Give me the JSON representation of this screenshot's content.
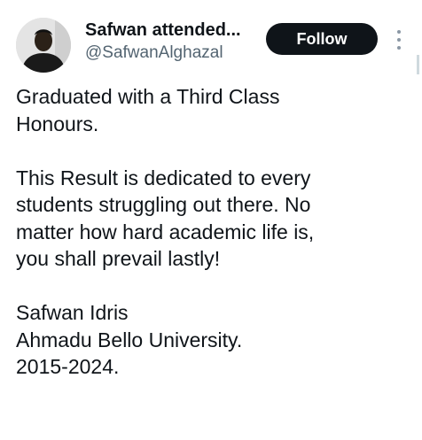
{
  "author": {
    "display_name": "Safwan attended...",
    "handle": "@SafwanAlghazal",
    "avatar_icon": "profile-photo-icon"
  },
  "actions": {
    "follow_label": "Follow",
    "more_icon": "more-vertical-icon"
  },
  "tweet": {
    "paragraph1": [
      "Graduated with a Third Class",
      "Honours."
    ],
    "paragraph2": [
      "This Result is dedicated to every",
      "students struggling out there. No",
      "matter how hard academic life is,",
      "you shall prevail lastly!"
    ],
    "paragraph3": [
      "Safwan Idris",
      "Ahmadu Bello University.",
      "2015-2024."
    ]
  },
  "colors": {
    "text": "#0f1419",
    "secondary_text": "#536471",
    "follow_bg": "#0f1419",
    "follow_text": "#ffffff"
  }
}
